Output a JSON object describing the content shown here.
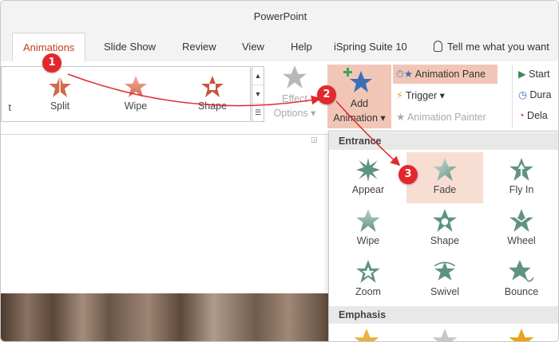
{
  "title": "PowerPoint",
  "tabs": [
    {
      "label": "Animations",
      "active": true
    },
    {
      "label": "Slide Show"
    },
    {
      "label": "Review"
    },
    {
      "label": "View"
    },
    {
      "label": "Help"
    },
    {
      "label": "iSpring Suite 10"
    }
  ],
  "tell_me": "Tell me what you want",
  "gallery": {
    "cut_label": "t",
    "items": [
      {
        "label": "Split",
        "icon": "split-star-icon"
      },
      {
        "label": "Wipe",
        "icon": "wipe-star-icon"
      },
      {
        "label": "Shape",
        "icon": "shape-star-icon"
      }
    ]
  },
  "effect_options": {
    "line1": "Effect",
    "line2": "Options"
  },
  "add_animation": {
    "line1": "Add",
    "line2": "Animation"
  },
  "animation_pane": "Animation Pane",
  "trigger": "Trigger",
  "animation_painter": "Animation Painter",
  "timing": {
    "start": "Start",
    "duration": "Dura",
    "delay": "Dela"
  },
  "dropdown": {
    "entrance_header": "Entrance",
    "emphasis_header": "Emphasis",
    "entrance_items": [
      {
        "label": "Appear",
        "icon": "appear-icon"
      },
      {
        "label": "Fade",
        "icon": "fade-icon",
        "highlighted": true
      },
      {
        "label": "Fly In",
        "icon": "fly-in-icon"
      },
      {
        "label": "Wipe",
        "icon": "wipe-icon"
      },
      {
        "label": "Shape",
        "icon": "shape-icon"
      },
      {
        "label": "Wheel",
        "icon": "wheel-icon"
      },
      {
        "label": "Zoom",
        "icon": "zoom-icon"
      },
      {
        "label": "Swivel",
        "icon": "swivel-icon"
      },
      {
        "label": "Bounce",
        "icon": "bounce-icon"
      }
    ]
  },
  "callouts": [
    "1",
    "2",
    "3"
  ],
  "colors": {
    "accent": "#c43e1c",
    "highlight": "#f2c6b6",
    "entrance_star": "#5f9381",
    "badge": "#e2282c"
  }
}
